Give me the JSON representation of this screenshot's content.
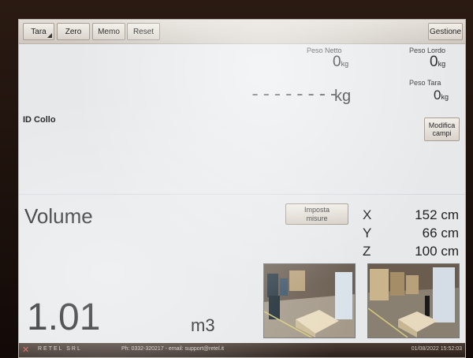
{
  "toolbar": {
    "tara_label": "Tara",
    "zero_label": "Zero",
    "memo_label": "Memo",
    "reset_label": "Reset",
    "gestione_label": "Gestione"
  },
  "weights": {
    "peso_netto_label": "Peso Netto",
    "peso_netto_value": "0",
    "peso_netto_unit": "kg",
    "peso_lordo_label": "Peso Lordo",
    "peso_lordo_value": "0",
    "peso_lordo_unit": "kg",
    "peso_tara_label": "Peso Tara",
    "peso_tara_value": "0",
    "peso_tara_unit": "kg",
    "display_value": "--------",
    "display_unit": "kg"
  },
  "collo": {
    "id_label": "ID Collo",
    "modifica_line1": "Modifica",
    "modifica_line2": "campi"
  },
  "volume": {
    "label": "Volume",
    "imposta_line1": "Imposta",
    "imposta_line2": "misure",
    "value": "1.01",
    "unit": "m3",
    "dims": [
      {
        "axis": "X",
        "value": "152",
        "unit": "cm"
      },
      {
        "axis": "Y",
        "value": "66",
        "unit": "cm"
      },
      {
        "axis": "Z",
        "value": "100",
        "unit": "cm"
      }
    ]
  },
  "status_bar": {
    "company": "RETEL SRL",
    "contact": "Ph: 0332-320217  -  email: support@retel.it",
    "datetime": "01/08/2022   15:52:03"
  }
}
